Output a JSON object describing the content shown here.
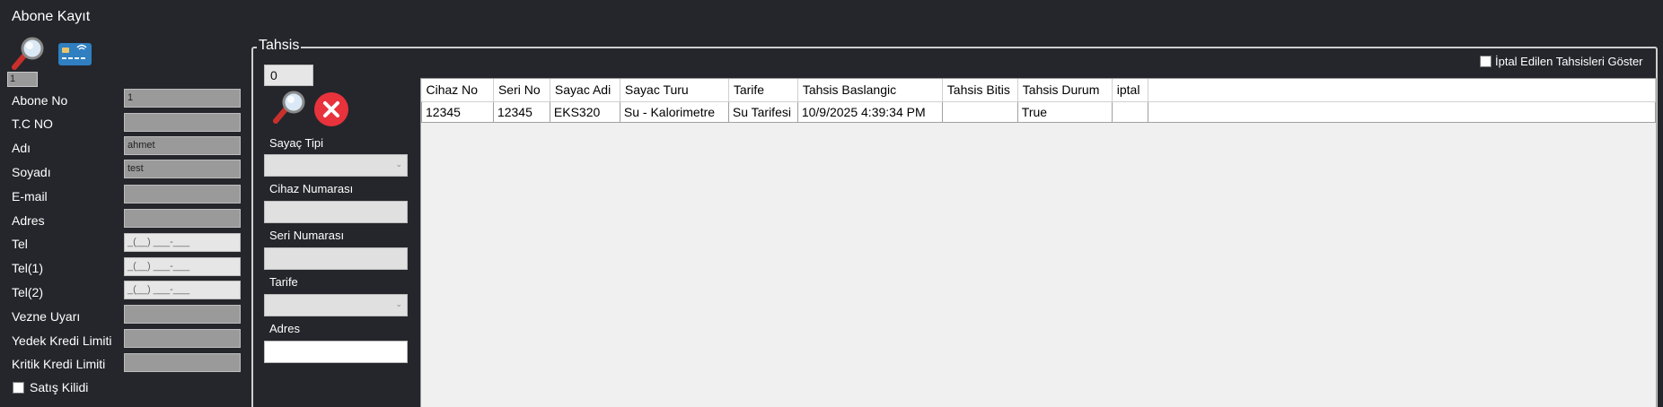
{
  "window": {
    "title": "Abone Kayıt"
  },
  "top": {
    "small_value": "1"
  },
  "form": {
    "fields": [
      {
        "label": "Abone No",
        "value": "1"
      },
      {
        "label": "T.C NO",
        "value": ""
      },
      {
        "label": "Adı",
        "value": "ahmet"
      },
      {
        "label": "Soyadı",
        "value": "test"
      },
      {
        "label": "E-mail",
        "value": ""
      },
      {
        "label": "Adres",
        "value": ""
      },
      {
        "label": "Tel",
        "value": "_(__) ___-___"
      },
      {
        "label": "Tel(1)",
        "value": "_(__) ___-___"
      },
      {
        "label": "Tel(2)",
        "value": "_(__) ___-___"
      },
      {
        "label": "Vezne Uyarı",
        "value": ""
      },
      {
        "label": "Yedek Kredi Limiti",
        "value": ""
      },
      {
        "label": "Kritik Kredi Limiti",
        "value": ""
      }
    ],
    "satis_kilidi_label": "Satış Kilidi"
  },
  "tahsis": {
    "legend": "Tahsis",
    "show_cancelled_label": "İptal Edilen Tahsisleri Göster",
    "count": "0",
    "sayac_tipi_label": "Sayaç Tipi",
    "cihaz_numarasi_label": "Cihaz Numarası",
    "seri_numarasi_label": "Seri Numarası",
    "tarife_label": "Tarife",
    "adres_label": "Adres"
  },
  "grid": {
    "columns": [
      "Cihaz No",
      "Seri No",
      "Sayac Adi",
      "Sayac Turu",
      "Tarife",
      "Tahsis Baslangic",
      "Tahsis Bitis",
      "Tahsis Durum",
      "iptal"
    ],
    "rows": [
      [
        "12345",
        "12345",
        "EKS320",
        "Su - Kalorimetre",
        "Su Tarifesi",
        "10/9/2025 4:39:34 PM",
        "",
        "True",
        ""
      ]
    ]
  },
  "colors": {
    "background": "#24262b",
    "field_gray": "#9a9a9a",
    "field_light": "#e6e6e6",
    "cancel_red": "#e8323c"
  }
}
